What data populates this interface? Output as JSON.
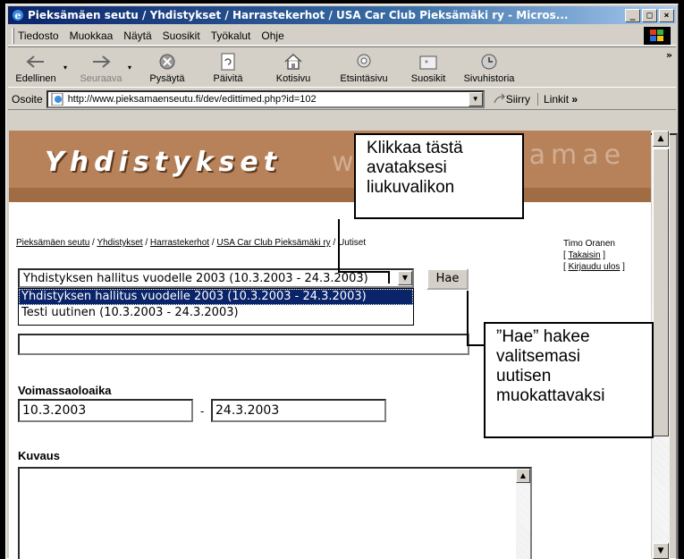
{
  "window": {
    "title": "Pieksämäen seutu / Yhdistykset / Harrastekerhot / USA Car Club Pieksämäki ry - Micros...",
    "min": "_",
    "max": "□",
    "close": "×"
  },
  "menubar": {
    "items": [
      "Tiedosto",
      "Muokkaa",
      "Näytä",
      "Suosikit",
      "Työkalut",
      "Ohje"
    ]
  },
  "toolbar": {
    "buttons": [
      {
        "label": "Edellinen",
        "icon": "back-arrow-icon"
      },
      {
        "label": "Seuraava",
        "icon": "forward-arrow-icon"
      },
      {
        "label": "Pysäytä",
        "icon": "stop-icon"
      },
      {
        "label": "Päivitä",
        "icon": "refresh-icon"
      },
      {
        "label": "Kotisivu",
        "icon": "home-icon"
      },
      {
        "label": "Etsintäsivu",
        "icon": "search-icon"
      },
      {
        "label": "Suosikit",
        "icon": "favorites-icon"
      },
      {
        "label": "Sivuhistoria",
        "icon": "history-icon"
      }
    ],
    "more": "»"
  },
  "addressbar": {
    "label": "Osoite",
    "url": "http://www.pieksamaenseutu.fi/dev/edittimed.php?id=102",
    "go": "Siirry",
    "links": "Linkit",
    "links_more": "»"
  },
  "page": {
    "banner_title": "Yhdistykset",
    "banner_watermark_left": "w",
    "banner_watermark_right": "samae",
    "breadcrumb": {
      "items": [
        "Pieksämäen seutu",
        "Yhdistykset",
        "Harrastekerhot",
        "USA Car Club Pieksämäki ry"
      ],
      "current": "Uutiset",
      "sep": " / "
    },
    "user": {
      "name": "Timo Oranen",
      "back": "Takaisin",
      "logout": "Kirjaudu ulos"
    },
    "news_select": {
      "value": "Yhdistyksen hallitus vuodelle 2003 (10.3.2003 - 24.3.2003)",
      "options": [
        "Yhdistyksen hallitus vuodelle 2003 (10.3.2003 - 24.3.2003)",
        "Testi uutinen (10.3.2003 - 24.3.2003)"
      ]
    },
    "hae_button": "Hae",
    "validity_label": "Voimassaoloaika",
    "date_start": "10.3.2003",
    "date_sep": "-",
    "date_end": "24.3.2003",
    "description_label": "Kuvaus"
  },
  "callouts": {
    "dropdown_hint": [
      "Klikkaa tästä",
      "avataksesi",
      "liukuvalikon"
    ],
    "hae_hint": [
      "”Hae” hakee",
      "valitsemasi",
      "uutisen",
      "muokattavaksi"
    ]
  }
}
